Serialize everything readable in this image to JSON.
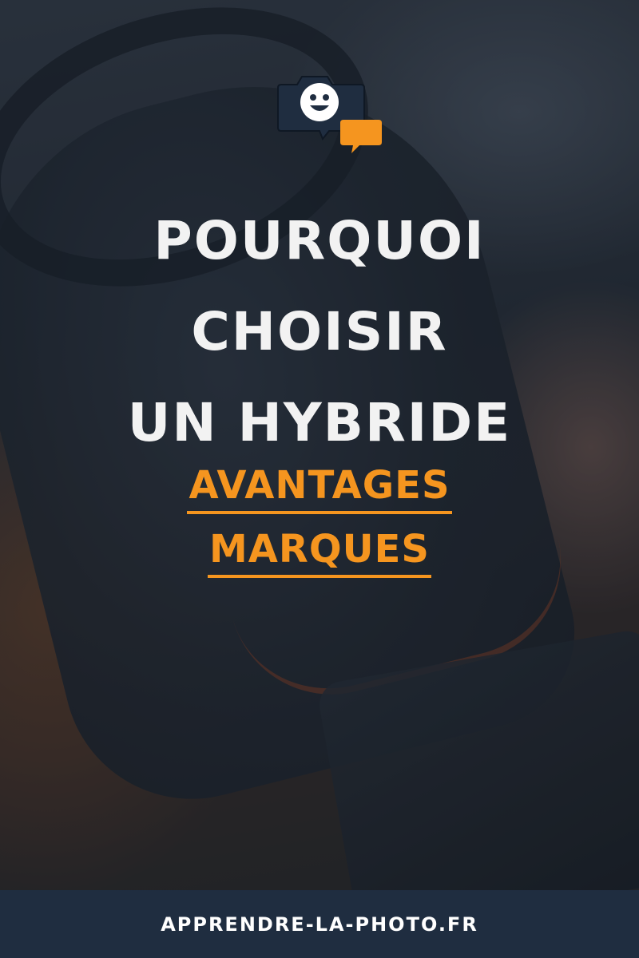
{
  "headline": {
    "lines": [
      "POURQUOI",
      "CHOISIR",
      "UN HYBRIDE"
    ]
  },
  "subheadline": {
    "lines": [
      "AVANTAGES",
      "MARQUES"
    ]
  },
  "footer": {
    "site": "APPRENDRE-LA-PHOTO.FR"
  },
  "logo": {
    "icon": "smiling-camera-chat-icon"
  },
  "colors": {
    "accent": "#f5951f",
    "headline": "#f2f2f2",
    "footer_bg": "#1f2d40"
  }
}
